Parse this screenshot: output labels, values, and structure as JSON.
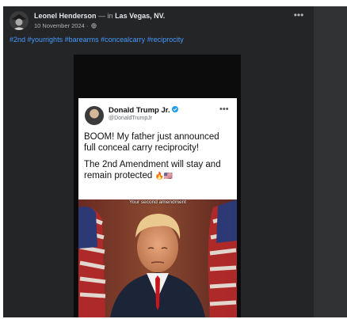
{
  "post": {
    "author": "Leonel Henderson",
    "separator": "— in",
    "location": "Las Vegas, NV.",
    "date": "10 November 2024 ·",
    "more_label": "•••",
    "hashtags": [
      "#2nd",
      "#yourrights",
      "#barearms",
      "#concealcarry",
      "#reciprocity"
    ]
  },
  "tweet": {
    "name": "Donald Trump Jr.",
    "handle": "@DonaldTrumpJr",
    "more_label": "•••",
    "paragraph1": "BOOM! My father just announced full conceal carry reciprocity!",
    "paragraph2": "The 2nd Amendment will stay and remain protected",
    "emojis": "🔥🇺🇸"
  },
  "video": {
    "caption": "Your second amendment"
  },
  "icons": {
    "globe": "globe-icon",
    "verified": "verified-badge-icon",
    "more": "more-options-icon"
  },
  "colors": {
    "post_bg": "#242526",
    "hashtag": "#4599ff",
    "verified": "#1d9bf0"
  }
}
